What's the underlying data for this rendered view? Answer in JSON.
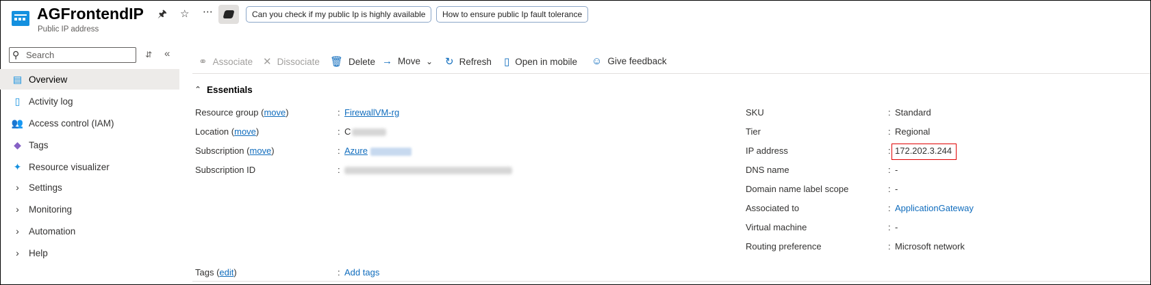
{
  "header": {
    "title": "AGFrontendIP",
    "subtitle": "Public IP address",
    "chips": [
      "Can you check if my public Ip is highly available",
      "How to ensure public Ip fault tolerance"
    ]
  },
  "sidebar": {
    "search_placeholder": "Search",
    "items": [
      {
        "label": "Overview",
        "icon": "overview-icon",
        "active": true
      },
      {
        "label": "Activity log",
        "icon": "activity-log-icon"
      },
      {
        "label": "Access control (IAM)",
        "icon": "people-icon"
      },
      {
        "label": "Tags",
        "icon": "tag-icon"
      },
      {
        "label": "Resource visualizer",
        "icon": "hierarchy-icon"
      },
      {
        "label": "Settings",
        "icon": "chevron-right-icon"
      },
      {
        "label": "Monitoring",
        "icon": "chevron-right-icon"
      },
      {
        "label": "Automation",
        "icon": "chevron-right-icon"
      },
      {
        "label": "Help",
        "icon": "chevron-right-icon"
      }
    ]
  },
  "toolbar": {
    "associate": "Associate",
    "dissociate": "Dissociate",
    "delete": "Delete",
    "move": "Move",
    "refresh": "Refresh",
    "open_mobile": "Open in mobile",
    "feedback": "Give feedback"
  },
  "essentials": {
    "title": "Essentials",
    "move_link": "move",
    "left": {
      "resource_group": {
        "label": "Resource group",
        "value": "FirewallVM-rg"
      },
      "location": {
        "label": "Location",
        "value": "C"
      },
      "subscription": {
        "label": "Subscription",
        "value": "Azure"
      },
      "subscription_id": {
        "label": "Subscription ID"
      }
    },
    "right": [
      {
        "label": "SKU",
        "value": "Standard"
      },
      {
        "label": "Tier",
        "value": "Regional"
      },
      {
        "label": "IP address",
        "value": "172.202.3.244"
      },
      {
        "label": "DNS name",
        "value": "-"
      },
      {
        "label": "Domain name label scope",
        "value": "-"
      },
      {
        "label": "Associated to",
        "value": "ApplicationGateway"
      },
      {
        "label": "Virtual machine",
        "value": "-"
      },
      {
        "label": "Routing preference",
        "value": "Microsoft network"
      }
    ],
    "tags": {
      "label": "Tags",
      "edit": "edit",
      "value": "Add tags"
    }
  },
  "colors": {
    "accent": "#0f6cbd",
    "active_bg": "#edebe9",
    "highlight": "#e00000"
  }
}
